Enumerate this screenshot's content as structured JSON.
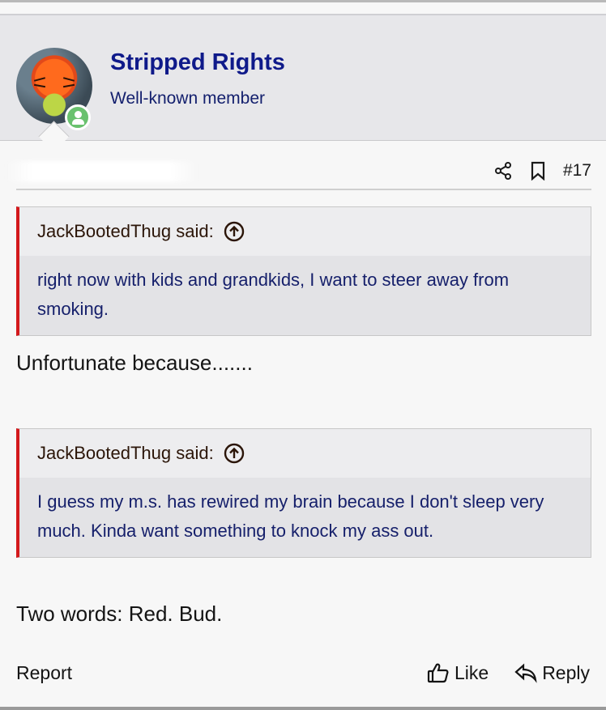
{
  "author": {
    "name": "Stripped Rights",
    "title": "Well-known member",
    "status_color": "#69c16e"
  },
  "toolbar": {
    "share_icon": "share-icon",
    "bookmark_icon": "bookmark-icon",
    "post_number": "#17"
  },
  "quotes": [
    {
      "author_said": "JackBootedThug said:",
      "text": "right now with kids and grandkids, I want to steer away from smoking."
    },
    {
      "author_said": "JackBootedThug said:",
      "text": "I guess my m.s. has rewired my brain because I don't sleep very much. Kinda want something to knock my ass out."
    }
  ],
  "replies": [
    "Unfortunate because.......",
    "Two words: Red. Bud."
  ],
  "footer": {
    "report_label": "Report",
    "like_label": "Like",
    "reply_label": "Reply"
  },
  "colors": {
    "username": "#0f1a8a",
    "quote_accent": "#d3191c",
    "quote_text": "#16206b"
  }
}
